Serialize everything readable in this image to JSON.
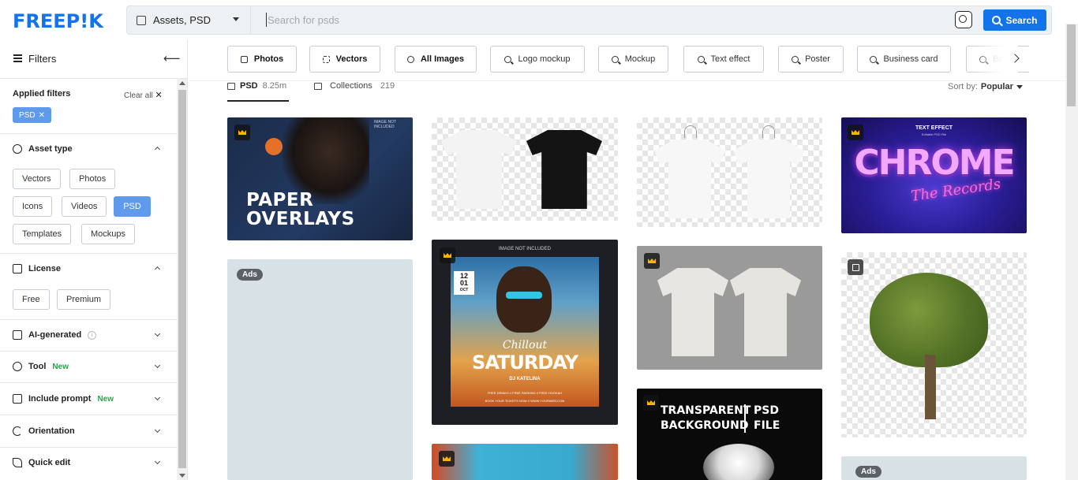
{
  "header": {
    "logo": "FREEP!K",
    "asset_select": "Assets, PSD",
    "search_placeholder": "Search for psds",
    "search_button": "Search"
  },
  "sidebar": {
    "title": "Filters",
    "applied_filters": "Applied filters",
    "clear_all": "Clear all",
    "applied_chip": "PSD",
    "asset_type": {
      "label": "Asset type",
      "options": [
        "Vectors",
        "Photos",
        "Icons",
        "Videos",
        "PSD",
        "Templates",
        "Mockups"
      ],
      "active": "PSD"
    },
    "license": {
      "label": "License",
      "options": [
        "Free",
        "Premium"
      ]
    },
    "ai_generated": "AI-generated",
    "tool": "Tool",
    "tool_badge": "New",
    "include_prompt": "Include prompt",
    "include_prompt_badge": "New",
    "orientation": "Orientation",
    "quick_edit": "Quick edit"
  },
  "categories": [
    "Photos",
    "Vectors",
    "All Images",
    "Logo mockup",
    "Mockup",
    "Text effect",
    "Poster",
    "Business card",
    "Ba"
  ],
  "tabs": [
    {
      "label": "PSD",
      "count": "8.25m"
    },
    {
      "label": "Collections",
      "count": "219"
    }
  ],
  "sort": {
    "label": "Sort by:",
    "value": "Popular"
  },
  "cards": {
    "paper_overlays": {
      "small": "IMAGE NOT INCLUDED",
      "line1": "PAPER",
      "line2": "OVERLAYS"
    },
    "flyer": {
      "top": "IMAGE NOT INCLUDED",
      "date_day": "12",
      "date_month": "01",
      "date_label": "OCT",
      "title1": "Chillout",
      "title2": "SATURDAY",
      "dj": "DJ KATELINA",
      "info": "FREE DRINKS // FREE PARKING // FREE HOOKAH",
      "book": "BOOK YOUR TICKETS NOW // WWW.YOURWEB.COM"
    },
    "chrome": {
      "small": "TEXT EFFECT",
      "sub": "Editable PSD File",
      "title": "CHROME",
      "script": "The Records"
    },
    "transparent": {
      "line1": "TRANSPARENT",
      "line2": "BACKGROUND",
      "psd": "PSD",
      "file": "FILE"
    },
    "ads_label": "Ads"
  }
}
